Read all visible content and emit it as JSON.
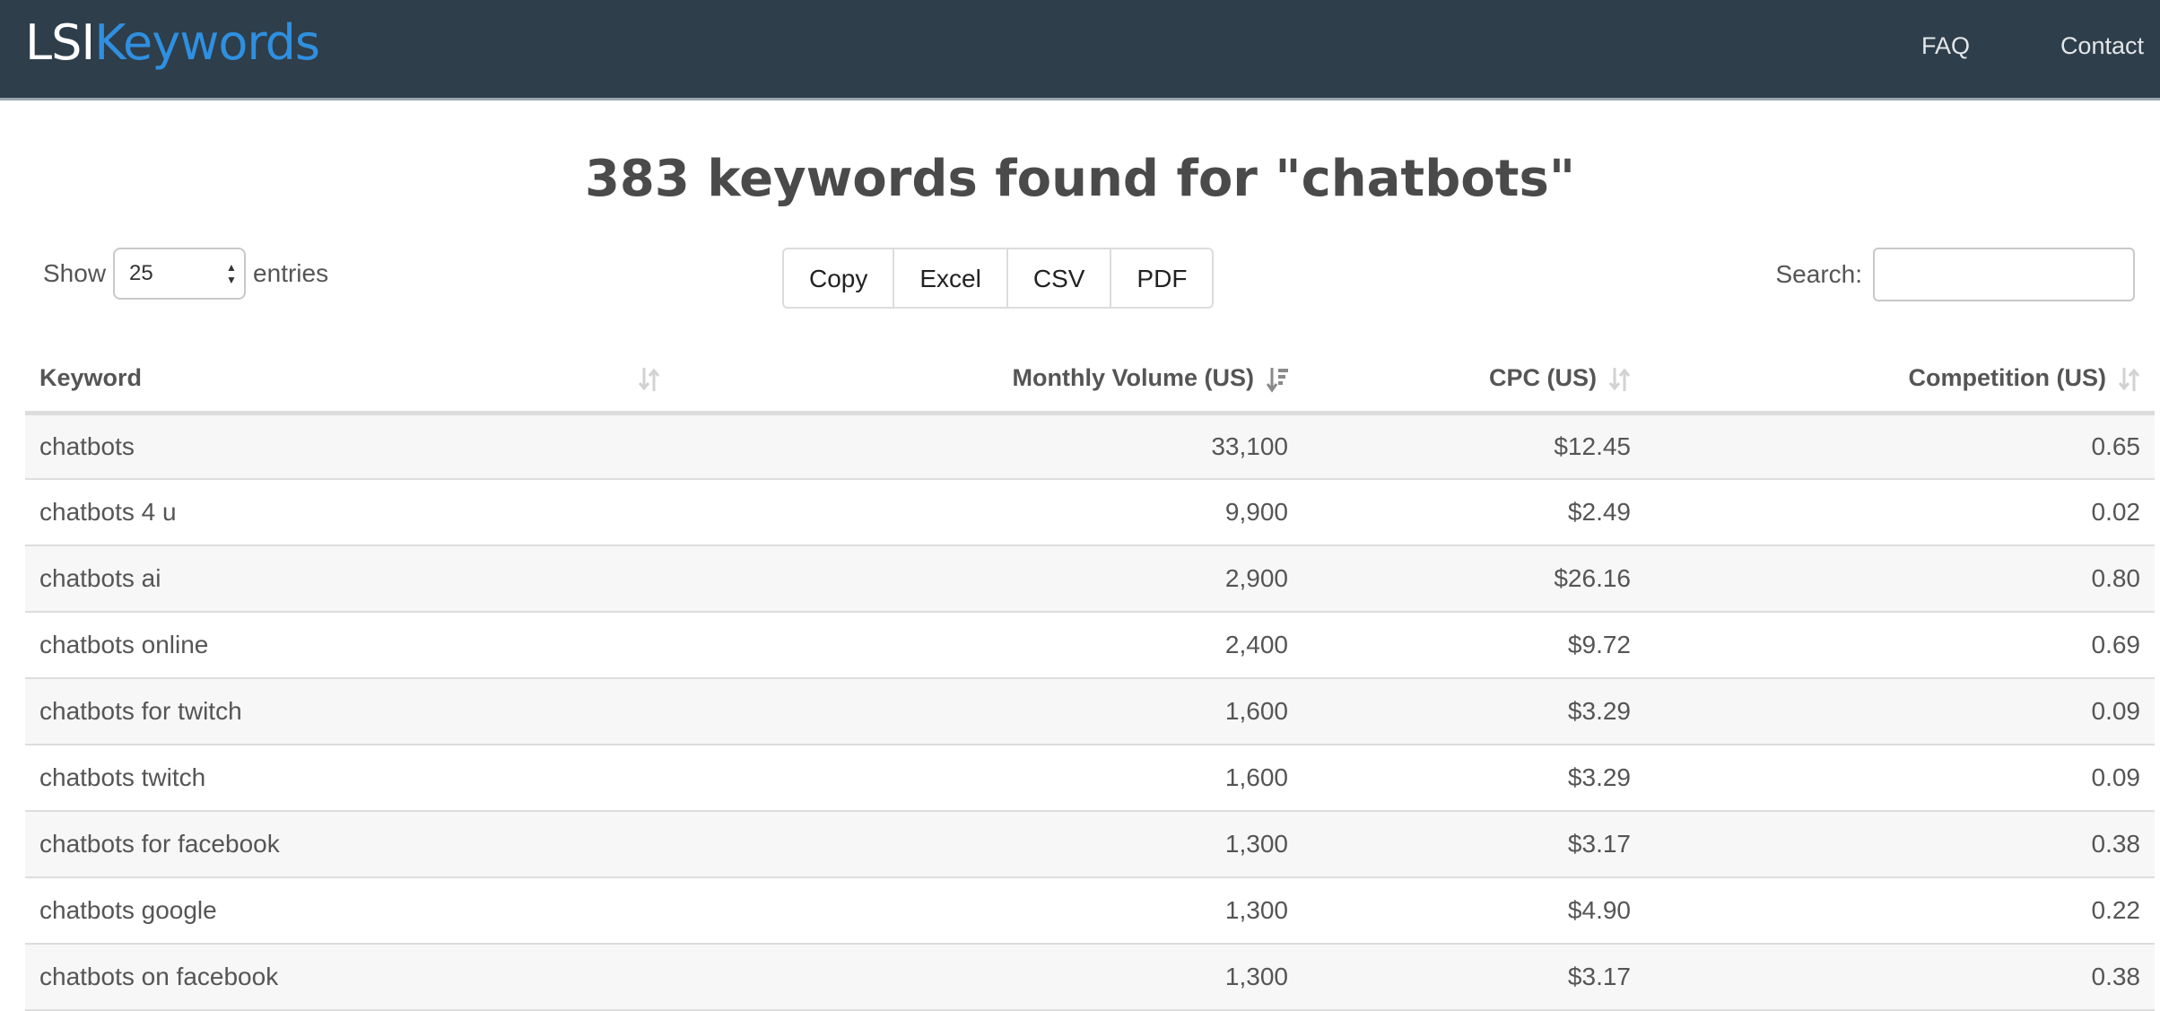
{
  "brand": {
    "part1": "LSI",
    "part2": "Keywords"
  },
  "nav": {
    "faq": "FAQ",
    "contact": "Contact"
  },
  "title": "383 keywords found for \"chatbots\"",
  "length": {
    "show_label": "Show",
    "value": "25",
    "entries_label": "entries"
  },
  "buttons": {
    "copy": "Copy",
    "excel": "Excel",
    "csv": "CSV",
    "pdf": "PDF"
  },
  "search": {
    "label": "Search:",
    "value": ""
  },
  "table": {
    "headers": {
      "keyword": "Keyword",
      "volume": "Monthly Volume (US)",
      "cpc": "CPC (US)",
      "competition": "Competition (US)"
    },
    "sorted_column": "volume",
    "sort_direction": "desc",
    "rows": [
      {
        "keyword": "chatbots",
        "volume": "33,100",
        "cpc": "$12.45",
        "competition": "0.65"
      },
      {
        "keyword": "chatbots 4 u",
        "volume": "9,900",
        "cpc": "$2.49",
        "competition": "0.02"
      },
      {
        "keyword": "chatbots ai",
        "volume": "2,900",
        "cpc": "$26.16",
        "competition": "0.80"
      },
      {
        "keyword": "chatbots online",
        "volume": "2,400",
        "cpc": "$9.72",
        "competition": "0.69"
      },
      {
        "keyword": "chatbots for twitch",
        "volume": "1,600",
        "cpc": "$3.29",
        "competition": "0.09"
      },
      {
        "keyword": "chatbots twitch",
        "volume": "1,600",
        "cpc": "$3.29",
        "competition": "0.09"
      },
      {
        "keyword": "chatbots for facebook",
        "volume": "1,300",
        "cpc": "$3.17",
        "competition": "0.38"
      },
      {
        "keyword": "chatbots google",
        "volume": "1,300",
        "cpc": "$4.90",
        "competition": "0.22"
      },
      {
        "keyword": "chatbots on facebook",
        "volume": "1,300",
        "cpc": "$3.17",
        "competition": "0.38"
      }
    ]
  },
  "colors": {
    "navbar": "#2e3e4a",
    "brand_accent": "#2f8fe0",
    "sort_inactive": "#d2d2d2",
    "sort_active": "#8a8a8a"
  }
}
